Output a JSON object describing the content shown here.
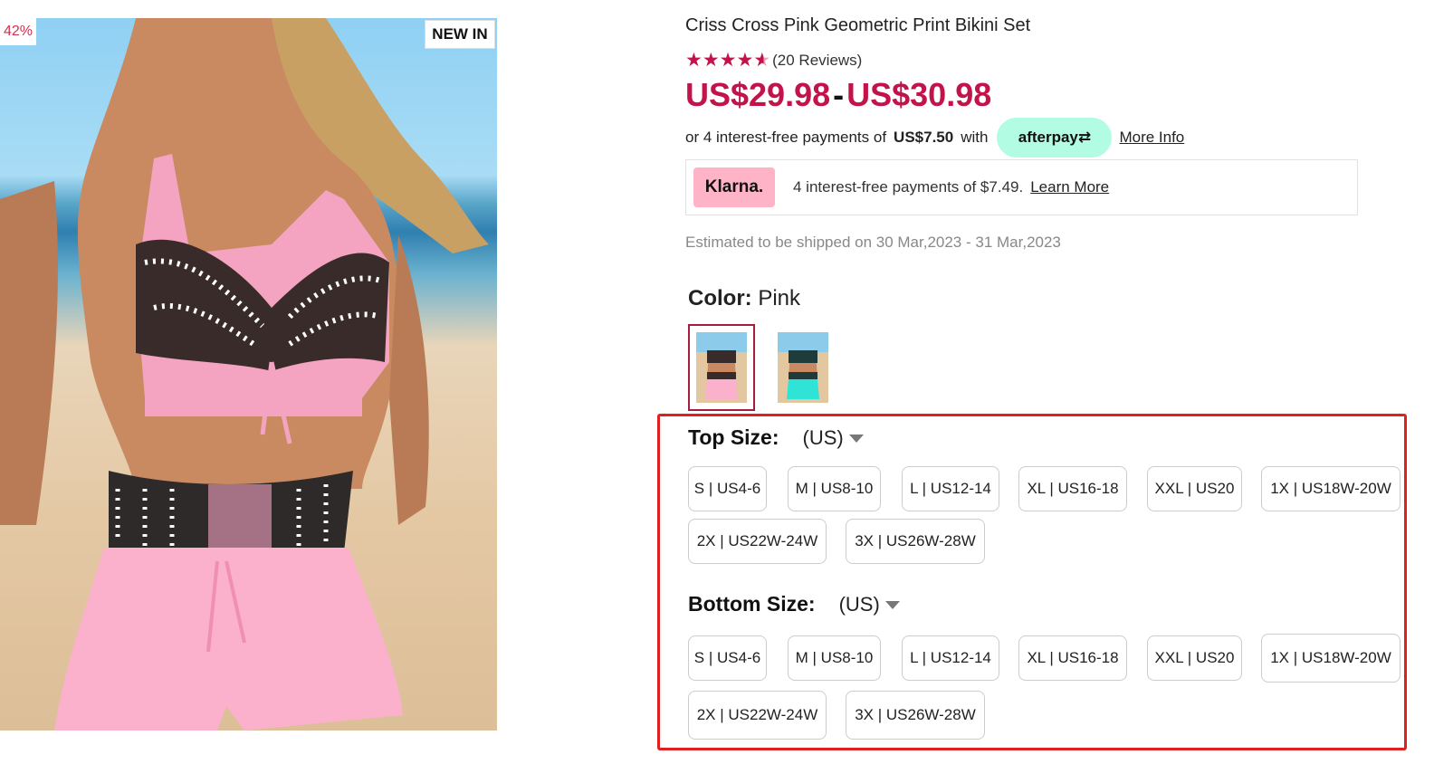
{
  "image": {
    "discount_badge": "42%",
    "new_badge": "NEW IN"
  },
  "product": {
    "title": "Criss Cross Pink Geometric Print Bikini Set",
    "rating": 4.5,
    "reviews": "(20 Reviews)",
    "price_low": "US$29.98",
    "price_sep": "-",
    "price_high": "US$30.98"
  },
  "afterpay": {
    "prefix": "or 4 interest-free payments of",
    "amount": "US$7.50",
    "with": "with",
    "logo_text": "afterpay⇄",
    "more_info": "More Info"
  },
  "klarna": {
    "logo_text": "Klarna.",
    "text": "4 interest-free payments of $7.49.",
    "learn_more": "Learn More"
  },
  "shipping": "Estimated to be shipped on 30 Mar,2023 - 31 Mar,2023",
  "color": {
    "label": "Color:",
    "value": "Pink",
    "options": [
      "pink",
      "turquoise"
    ]
  },
  "top_size": {
    "label": "Top Size:",
    "unit": "(US)",
    "options": [
      "S | US4-6",
      "M | US8-10",
      "L | US12-14",
      "XL | US16-18",
      "XXL | US20",
      "1X | US18W-20W",
      "2X | US22W-24W",
      "3X | US26W-28W"
    ]
  },
  "bottom_size": {
    "label": "Bottom Size:",
    "unit": "(US)",
    "options": [
      "S | US4-6",
      "M | US8-10",
      "L | US12-14",
      "XL | US16-18",
      "XXL | US20",
      "1X | US18W-20W",
      "2X | US22W-24W",
      "3X | US26W-28W"
    ]
  },
  "colors": {
    "accent": "#c2144a",
    "highlight_border": "#e02020",
    "afterpay_mint": "#b2fce4",
    "klarna_pink": "#ffb3c7"
  }
}
